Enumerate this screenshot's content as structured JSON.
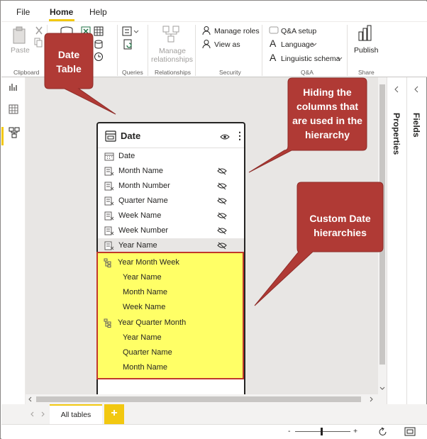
{
  "menu": {
    "file": "File",
    "home": "Home",
    "help": "Help"
  },
  "ribbon": {
    "paste": "Paste",
    "clipboard": "Clipboard",
    "queries": "Queries",
    "manage_rel_1": "Manage",
    "manage_rel_2": "relationships",
    "relationships": "Relationships",
    "manage_roles": "Manage roles",
    "view_as": "View as",
    "security": "Security",
    "qa_setup": "Q&A setup",
    "language": "Language",
    "linguistic_schema": "Linguistic schema",
    "qa": "Q&A",
    "publish": "Publish",
    "share": "Share"
  },
  "panes": {
    "properties": "Properties",
    "fields": "Fields"
  },
  "table": {
    "title": "Date",
    "columns": [
      {
        "label": "Date",
        "hidden": false
      },
      {
        "label": "Month Name",
        "hidden": true
      },
      {
        "label": "Month Number",
        "hidden": true
      },
      {
        "label": "Quarter Name",
        "hidden": true
      },
      {
        "label": "Week Name",
        "hidden": true
      },
      {
        "label": "Week Number",
        "hidden": true
      },
      {
        "label": "Year Name",
        "hidden": true
      }
    ],
    "hierarchies": [
      {
        "label": "Year Month Week",
        "levels": [
          "Year Name",
          "Month Name",
          "Week Name"
        ]
      },
      {
        "label": "Year Quarter Month",
        "levels": [
          "Year Name",
          "Quarter Name",
          "Month Name"
        ]
      }
    ]
  },
  "callouts": {
    "date_table_1": "Date",
    "date_table_2": "Table",
    "hiding_1": "Hiding the",
    "hiding_2": "columns that",
    "hiding_3": "are used in the",
    "hiding_4": "hierarchy",
    "custom_1": "Custom Date",
    "custom_2": "hierarchies"
  },
  "tabs": {
    "all_tables": "All tables",
    "add": "+"
  },
  "status": {
    "zoom_minus": "-",
    "zoom_plus": "+"
  },
  "colors": {
    "accent": "#f2c811",
    "callout": "#b03a35",
    "highlight": "#ffff66",
    "highlight_border": "#c0392b"
  }
}
